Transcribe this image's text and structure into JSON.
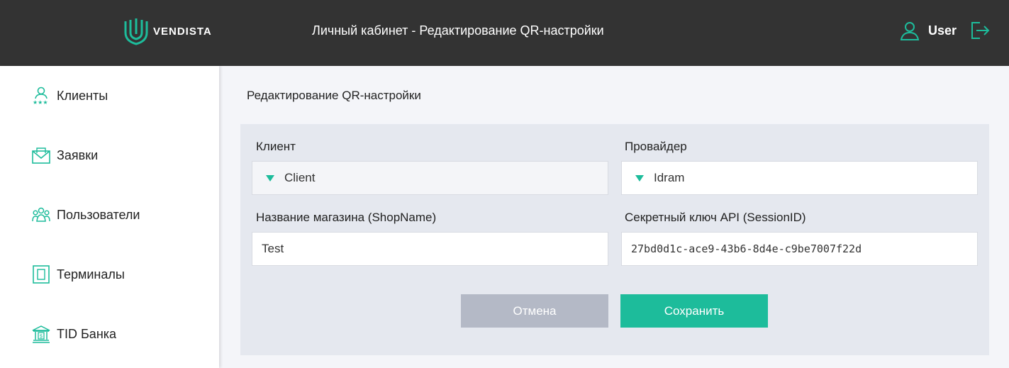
{
  "header": {
    "logo_text": "VENDISTA",
    "title": "Личный кабинет - Редактирование QR-настройки",
    "user_name": "User"
  },
  "sidebar": {
    "items": [
      {
        "label": "Клиенты",
        "icon": "clients-icon"
      },
      {
        "label": "Заявки",
        "icon": "envelope-icon"
      },
      {
        "label": "Пользователи",
        "icon": "users-icon"
      },
      {
        "label": "Терминалы",
        "icon": "terminal-icon"
      },
      {
        "label": "TID Банка",
        "icon": "bank-icon"
      }
    ]
  },
  "page": {
    "title": "Редактирование QR-настройки"
  },
  "form": {
    "client": {
      "label": "Клиент",
      "value": "Client"
    },
    "provider": {
      "label": "Провайдер",
      "value": "Idram"
    },
    "shop_name": {
      "label": "Название магазина (ShopName)",
      "value": "Test"
    },
    "secret_key": {
      "label": "Секретный ключ API (SessionID)",
      "value": "27bd0d1c-ace9-43b6-8d4e-c9be7007f22d"
    },
    "cancel_label": "Отмена",
    "save_label": "Сохранить"
  },
  "colors": {
    "accent": "#1dbc9b",
    "header_bg": "#333333",
    "cancel_bg": "#b4b9c6"
  }
}
